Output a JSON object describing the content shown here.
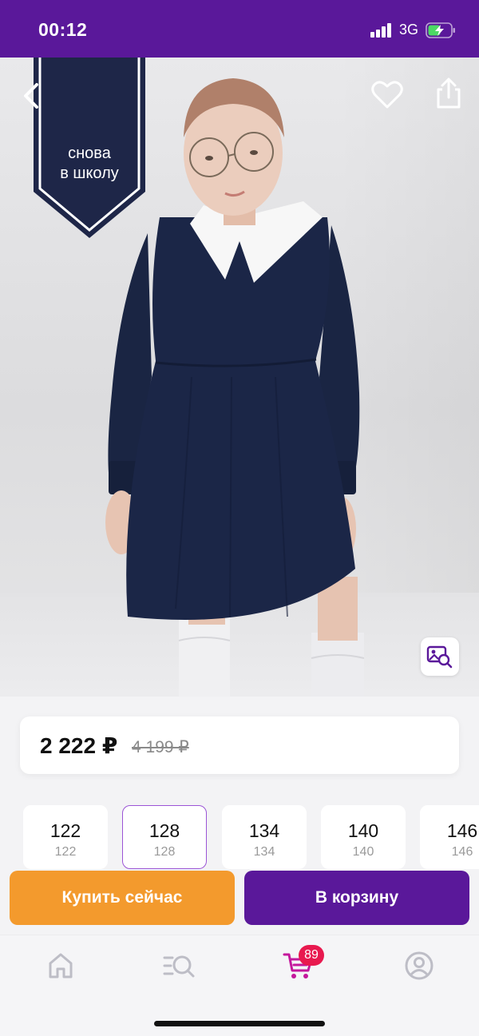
{
  "status_bar": {
    "time": "00:12",
    "network": "3G",
    "background_color": "#5a189a"
  },
  "product_image": {
    "promo_banner_line1": "снова",
    "promo_banner_line2": "в школу",
    "icons": [
      "back-icon",
      "heart-icon",
      "share-icon",
      "image-search-icon"
    ]
  },
  "price": {
    "current": "2 222 ₽",
    "old": "4 199 ₽"
  },
  "sizes": [
    {
      "main": "122",
      "sub": "122",
      "selected": false
    },
    {
      "main": "128",
      "sub": "128",
      "selected": true
    },
    {
      "main": "134",
      "sub": "134",
      "selected": false
    },
    {
      "main": "140",
      "sub": "140",
      "selected": false
    },
    {
      "main": "146",
      "sub": "146",
      "selected": false
    }
  ],
  "actions": {
    "buy_now_label": "Купить сейчас",
    "add_to_cart_label": "В корзину",
    "buy_now_color": "#f39a2d",
    "add_to_cart_color": "#5a189a"
  },
  "bottom_nav": {
    "items": [
      "home-icon",
      "catalog-search-icon",
      "cart-icon",
      "profile-icon"
    ],
    "active": "cart-icon",
    "cart_badge": "89",
    "active_color": "#c4189c",
    "badge_color": "#e8194f"
  }
}
